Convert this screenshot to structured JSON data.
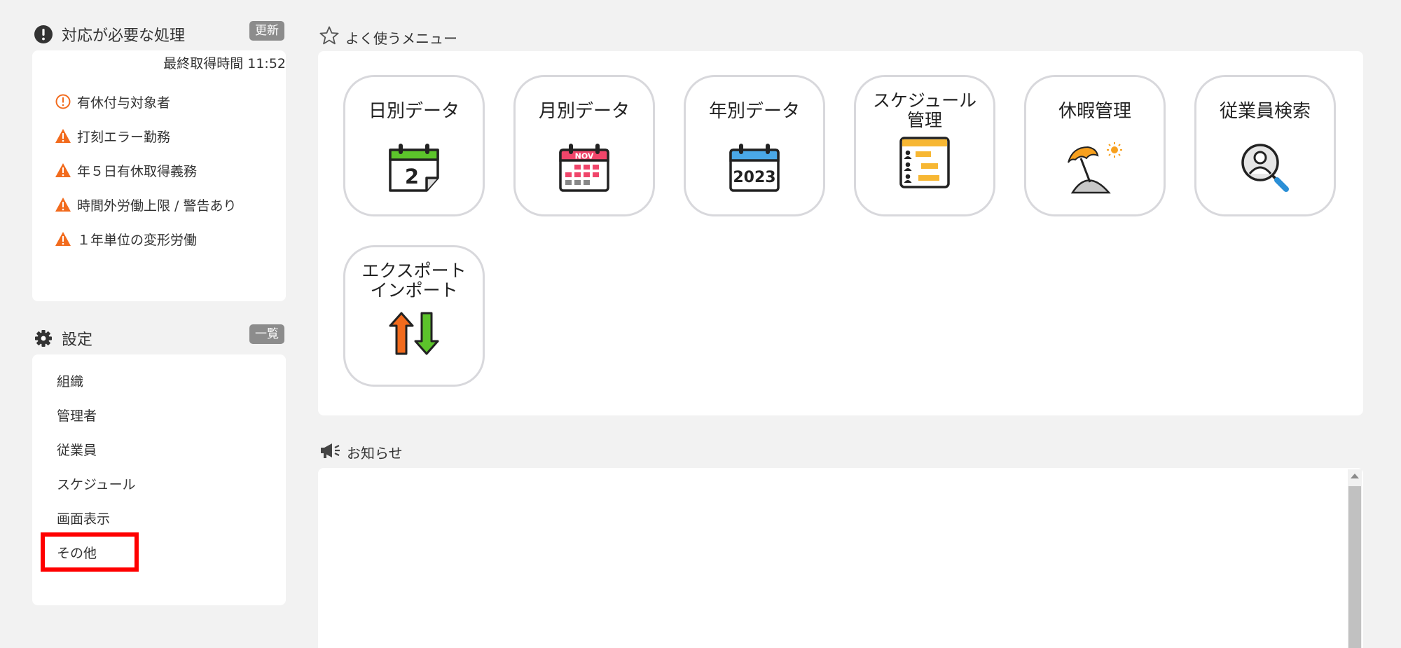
{
  "alerts": {
    "title": "対応が必要な処理",
    "refresh_label": "更新",
    "last_fetched": "最終取得時間 11:52",
    "items": [
      {
        "label": "有休付与対象者",
        "icon": "info-circle-icon"
      },
      {
        "label": "打刻エラー勤務",
        "icon": "warning-triangle-icon"
      },
      {
        "label": "年５日有休取得義務",
        "icon": "warning-triangle-icon"
      },
      {
        "label": "時間外労働上限 / 警告あり",
        "icon": "warning-triangle-icon"
      },
      {
        "label": "１年単位の変形労働",
        "icon": "warning-triangle-icon"
      }
    ]
  },
  "settings": {
    "title": "設定",
    "list_label": "一覧",
    "items": [
      "組織",
      "管理者",
      "従業員",
      "スケジュール",
      "画面表示",
      "その他"
    ]
  },
  "favorites": {
    "title": "よく使うメニュー",
    "tiles": [
      {
        "label": "日別データ",
        "icon": "calendar-day-icon",
        "icon_text": "2"
      },
      {
        "label": "月別データ",
        "icon": "calendar-month-icon",
        "icon_text": "NOV"
      },
      {
        "label": "年別データ",
        "icon": "calendar-year-icon",
        "icon_text": "2023"
      },
      {
        "label_line1": "スケジュール",
        "label_line2": "管理",
        "icon": "schedule-chart-icon"
      },
      {
        "label": "休暇管理",
        "icon": "beach-umbrella-icon"
      },
      {
        "label": "従業員検索",
        "icon": "employee-search-icon"
      },
      {
        "label_line1": "エクスポート",
        "label_line2": "インポート",
        "icon": "export-import-arrows-icon"
      }
    ]
  },
  "notices": {
    "title": "お知らせ"
  },
  "colors": {
    "warning": "#f26b1d",
    "highlight": "#ff0000",
    "badge": "#8c8c8c",
    "tile_border": "#d8d8dc"
  }
}
